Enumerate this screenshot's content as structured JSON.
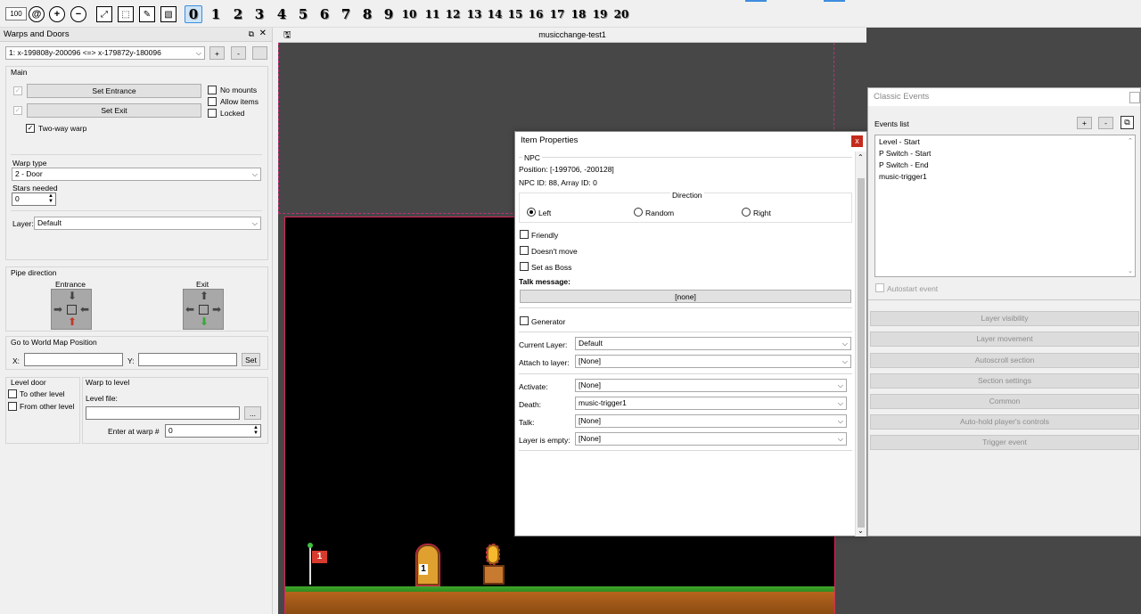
{
  "toolbar": {
    "zoom": "100",
    "layers": [
      "0",
      "1",
      "2",
      "3",
      "4",
      "5",
      "6",
      "7",
      "8",
      "9",
      "10",
      "11",
      "12",
      "13",
      "14",
      "15",
      "16",
      "17",
      "18",
      "19",
      "20"
    ]
  },
  "warps_panel": {
    "title": "Warps and Doors",
    "warp_select": "1: x-199808y-200096 <=> x-179872y-180096",
    "add_label": "+",
    "remove_label": "-",
    "main_group": "Main",
    "set_entrance": "Set Entrance",
    "set_exit": "Set Exit",
    "no_mounts": "No mounts",
    "allow_items": "Allow items",
    "locked": "Locked",
    "two_way": "Two-way warp",
    "warp_type_label": "Warp type",
    "warp_type_value": "2 - Door",
    "stars_label": "Stars needed",
    "stars_value": "0",
    "layer_label": "Layer:",
    "layer_value": "Default",
    "pipe_group": "Pipe direction",
    "entrance_label": "Entrance",
    "exit_label": "Exit",
    "world_group": "Go to World Map Position",
    "x_label": "X:",
    "y_label": "Y:",
    "set_label": "Set",
    "level_door_group": "Level door",
    "to_other": "To other level",
    "from_other": "From other level",
    "warp_to_level_group": "Warp to level",
    "level_file_label": "Level file:",
    "browse_label": "...",
    "enter_warp_label": "Enter at warp #",
    "enter_warp_value": "0"
  },
  "canvas": {
    "tab_title": "musicchange-test1"
  },
  "item_props": {
    "title": "Item Properties",
    "close": "x",
    "group": "NPC",
    "position": "Position: [-199706, -200128]",
    "ids": "NPC ID: 88, Array ID: 0",
    "direction_label": "Direction",
    "dir_left": "Left",
    "dir_random": "Random",
    "dir_right": "Right",
    "friendly": "Friendly",
    "doesnt_move": "Doesn't move",
    "set_as_boss": "Set as Boss",
    "talk_message": "Talk message:",
    "talk_value": "[none]",
    "generator": "Generator",
    "current_layer_label": "Current Layer:",
    "current_layer_value": "Default",
    "attach_label": "Attach to layer:",
    "attach_value": "[None]",
    "activate_label": "Activate:",
    "activate_value": "[None]",
    "death_label": "Death:",
    "death_value": "music-trigger1",
    "talk_label": "Talk:",
    "talk_event_value": "[None]",
    "layer_empty_label": "Layer is empty:",
    "layer_empty_value": "[None]"
  },
  "events": {
    "title": "Classic Events",
    "list_label": "Events list",
    "add": "+",
    "remove": "-",
    "items": [
      "Level - Start",
      "P Switch - Start",
      "P Switch - End",
      "music-trigger1"
    ],
    "autostart": "Autostart event",
    "buttons": [
      "Layer visibility",
      "Layer movement",
      "Autoscroll section",
      "Section settings",
      "Common",
      "Auto-hold player's controls",
      "Trigger event"
    ]
  },
  "sprites": {
    "flag_number": "1",
    "door_number": "1"
  }
}
